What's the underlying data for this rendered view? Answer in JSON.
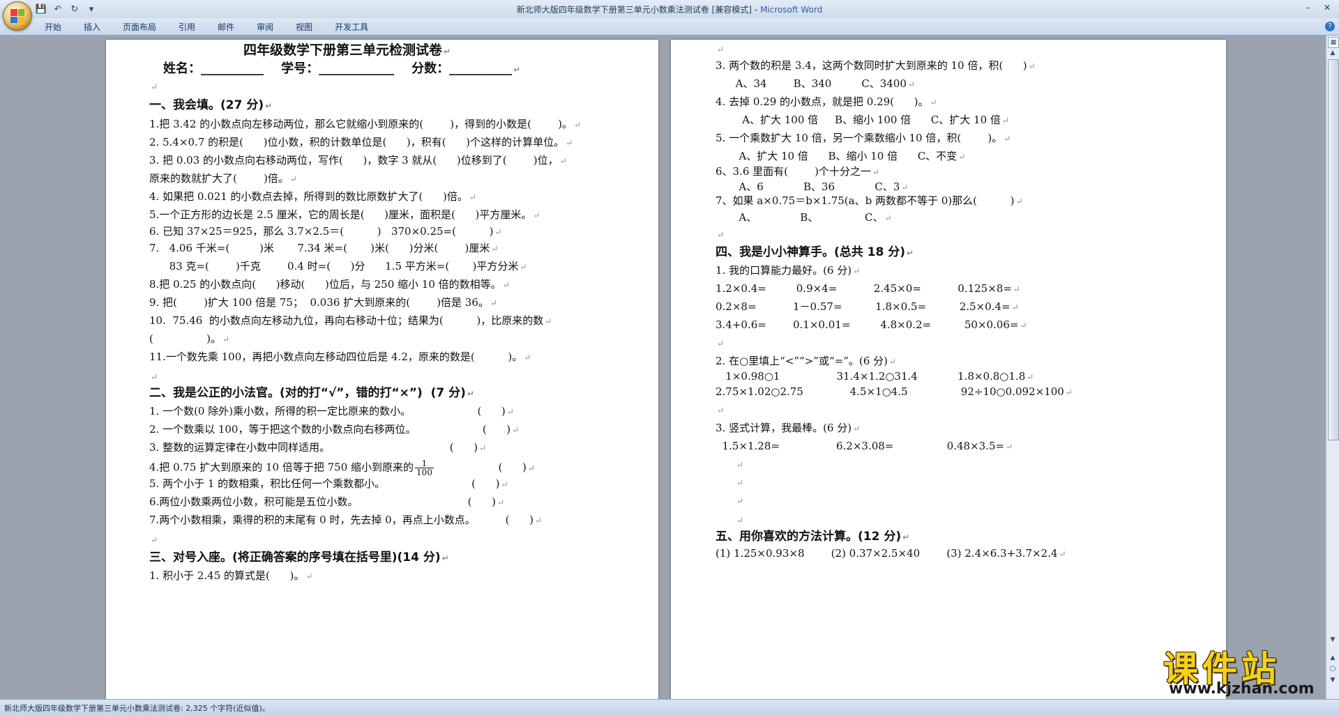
{
  "window": {
    "title": "新北师大版四年级数学下册第三单元小数乘法测试卷 [兼容模式]",
    "app": "Microsoft Word",
    "separator": " - "
  },
  "quick_access": {
    "save": "save-icon",
    "undo": "undo-icon",
    "redo": "redo-icon",
    "customize": "dropdown-icon"
  },
  "ribbon": {
    "tabs": [
      "开始",
      "插入",
      "页面布局",
      "引用",
      "邮件",
      "审阅",
      "视图",
      "开发工具"
    ]
  },
  "status_bar": {
    "text": "新北师大版四年级数学下册第三单元小数乘法测试卷: 2,325 个字符(近似值)。"
  },
  "watermark": {
    "text": "课件站",
    "url": "www.kjzhan.com"
  },
  "page_left": {
    "title": "四年级数学下册第三单元检测试卷",
    "fields": "姓名：__________    学号：____________    分数：__________",
    "lines": [
      {
        "t": "",
        "k": "blank"
      },
      {
        "t": "一、我会填。(27 分)",
        "k": "h"
      },
      {
        "t": "1.把 3.42 的小数点向左移动两位，那么它就缩小到原来的(        )，得到的小数是(        )。"
      },
      {
        "t": "2. 5.4×0.7 的积是(      )位小数，积的计数单位是(      )，积有(      )个这样的计算单位。"
      },
      {
        "t": "3. 把 0.03 的小数点向右移动两位，写作(      )，数字 3 就从(      )位移到了(        )位，"
      },
      {
        "t": "原来的数就扩大了(        )倍。"
      },
      {
        "t": "4. 如果把 0.021 的小数点去掉，所得到的数比原数扩大了(      )倍。"
      },
      {
        "t": "5.一个正方形的边长是 2.5 厘米，它的周长是(      )厘米，面积是(      )平方厘米。"
      },
      {
        "t": "6. 已知 37×25＝925，那么 3.7×2.5＝(          )   370×0.25=(          )"
      },
      {
        "t": "7.   4.06 千米=(         )米       7.34 米=(       )米(      )分米(        )厘米"
      },
      {
        "t": "      83 克=(        )千克        0.4 时=(      )分      1.5 平方米=(       )平方分米"
      },
      {
        "t": "8.把 0.25 的小数点向(      )移动(      )位后，与 250 缩小 10 倍的数相等。"
      },
      {
        "t": "9. 把(        )扩大 100 倍是 75；  0.036 扩大到原来的(        )倍是 36。"
      },
      {
        "t": "10.  75.46  的小数点向左移动九位，再向右移动十位；结果为(          )，比原来的数"
      },
      {
        "t": "(                )。"
      },
      {
        "t": "11.一个数先乘 100，再把小数点向左移动四位后是 4.2，原来的数是(          )。"
      },
      {
        "t": "",
        "k": "blank"
      },
      {
        "t": "二、我是公正的小法官。(对的打“√”，错的打“×”)  (7 分)",
        "k": "h"
      },
      {
        "t": "1. 一个数(0 除外)乘小数，所得的积一定比原来的数小。                    (      )"
      },
      {
        "t": "2. 一个数乘以 100，等于把这个数的小数点向右移两位。                    (      )"
      },
      {
        "t": "3. 整数的运算定律在小数中同样适用。                                    (      )"
      },
      {
        "t": "4.把 0.75 扩大到原来的 10 倍等于把 750 缩小到原来的",
        "frac": {
          "num": "1",
          "den": "100"
        },
        "tail": "                   (      )"
      },
      {
        "t": "5. 两个小于 1 的数相乘，积比任何一个乘数都小。                          (      )"
      },
      {
        "t": "6.两位小数乘两位小数，积可能是五位小数。                                 (      )"
      },
      {
        "t": "7.两个小数相乘，乘得的积的末尾有 0 时，先去掉 0，再点上小数点。         (      )"
      },
      {
        "t": "",
        "k": "blank"
      },
      {
        "t": "三、对号入座。(将正确答案的序号填在括号里)(14 分)",
        "k": "h"
      },
      {
        "t": "1. 积小于 2.45 的算式是(      )。"
      }
    ]
  },
  "page_right": {
    "lines": [
      {
        "t": "",
        "k": "blank"
      },
      {
        "t": "3. 两个数的积是 3.4，这两个数同时扩大到原来的 10 倍，积(      )"
      },
      {
        "t": "      A、34        B、340         C、3400"
      },
      {
        "t": "4. 去掉 0.29 的小数点，就是把 0.29(      )。"
      },
      {
        "t": "        A、扩大 100 倍     B、缩小 100 倍      C、扩大 10 倍"
      },
      {
        "t": "5. 一个乘数扩大 10 倍，另一个乘数缩小 10 倍，积(        )。"
      },
      {
        "t": "       A、扩大 10 倍      B、缩小 10 倍      C、不变"
      },
      {
        "t": "6、3.6 里面有(        )个十分之一"
      },
      {
        "t": "       A、6            B、36            C、3"
      },
      {
        "t": "7、如果 a×0.75＝b×1.75(a、b 两数都不等于 0)那么(          )"
      },
      {
        "t": "       A、             B、              C、"
      },
      {
        "t": "",
        "k": "blank"
      },
      {
        "t": "四、我是小小神算手。(总共 18 分)",
        "k": "h"
      },
      {
        "t": "1. 我的口算能力最好。(6 分)"
      },
      {
        "t": "1.2×0.4=         0.9×4=           2.45×0=           0.125×8="
      },
      {
        "t": "0.2×8=           1－0.57=          1.8×0.5=          2.5×0.4="
      },
      {
        "t": "3.4+0.6=        0.1×0.01=         4.8×0.2=          50×0.06="
      },
      {
        "t": "",
        "k": "blank"
      },
      {
        "t": "2. 在○里填上“<”“>”或“=”。(6 分)"
      },
      {
        "t": "   1×0.98○1                 31.4×1.2○31.4            1.8×0.8○1.8"
      },
      {
        "t": "2.75×1.02○2.75              4.5×1○4.5                92÷10○0.092×100"
      },
      {
        "t": "",
        "k": "blank"
      },
      {
        "t": "3. 竖式计算，我最棒。(6 分)"
      },
      {
        "t": "  1.5×1.28=                 6.2×3.08=                0.48×3.5="
      },
      {
        "t": "",
        "k": "blank"
      },
      {
        "t": "",
        "k": "blank"
      },
      {
        "t": "",
        "k": "blank"
      },
      {
        "t": "",
        "k": "blank"
      },
      {
        "t": "五、用你喜欢的方法计算。(12 分)",
        "k": "h"
      },
      {
        "t": "(1) 1.25×0.93×8        (2) 0.37×2.5×40        (3) 2.4×6.3+3.7×2.4"
      }
    ]
  },
  "colors": {
    "workspace": "#9aa3ae",
    "ribbon": "#cfdbea",
    "title_app": "#2c5fa8",
    "watermark_text": "#f7d21a"
  }
}
